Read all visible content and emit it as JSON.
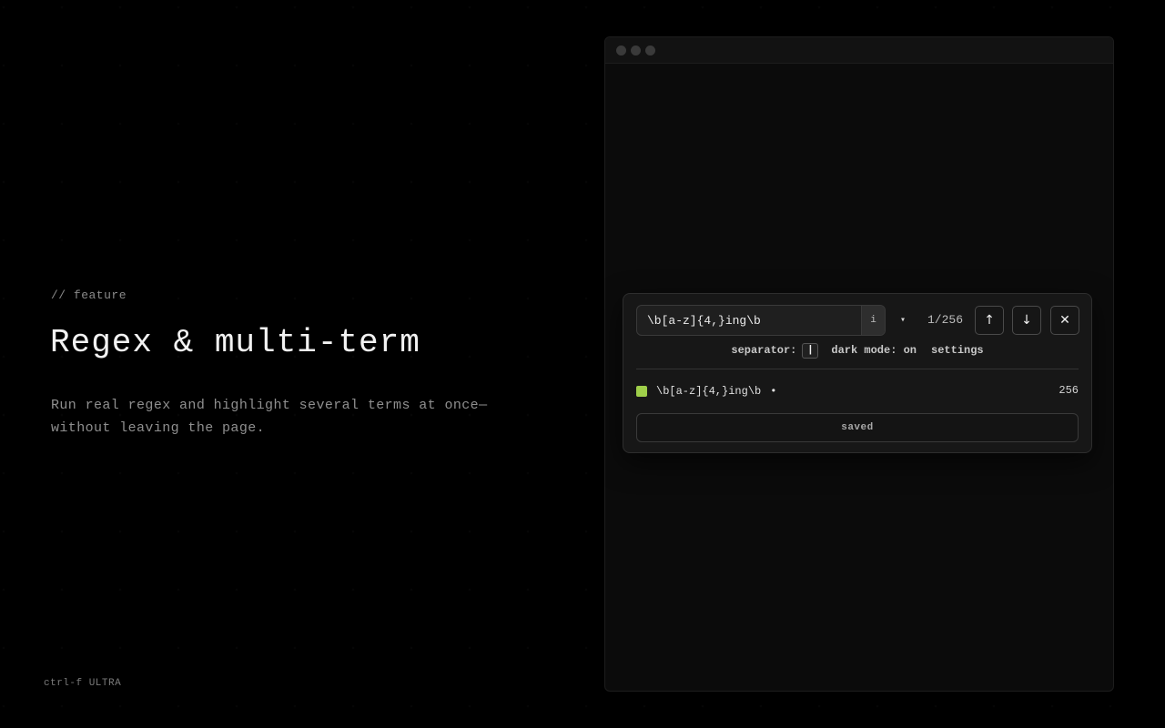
{
  "hero": {
    "eyebrow": "// feature",
    "title": "Regex & multi-term",
    "description": "Run real regex and highlight several terms at once—without leaving the page."
  },
  "footer": {
    "brand": "ctrl-f ULTRA"
  },
  "find_panel": {
    "query": "\\b[a-z]{4,}ing\\b",
    "regex_flag_label": "i",
    "dropdown_icon": "▾",
    "match_counter": "1/256",
    "prev_icon": "↑",
    "next_icon": "↓",
    "close_icon": "✕",
    "options": {
      "separator_label": "separator:",
      "separator_value": "|",
      "dark_mode_label": "dark mode: on",
      "settings_label": "settings"
    },
    "terms": [
      {
        "text": "\\b[a-z]{4,}ing\\b",
        "bullet": "•",
        "count": "256",
        "color": "#9fcf4a"
      }
    ],
    "saved_label": "saved"
  },
  "colors": {
    "background": "#000000",
    "accent_green": "#9fcf4a",
    "panel": "#171717"
  }
}
